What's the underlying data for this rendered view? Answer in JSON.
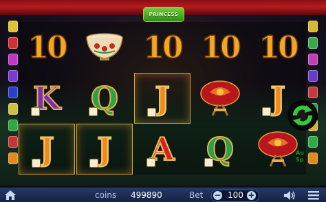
{
  "game": {
    "logo_text": "PRINCESS",
    "reels": [
      [
        "10",
        "K",
        "J"
      ],
      [
        "bowl",
        "Q",
        "J"
      ],
      [
        "10",
        "J",
        "A"
      ],
      [
        "10",
        "lantern",
        "Q"
      ],
      [
        "10",
        "J",
        "lantern"
      ]
    ],
    "winning_cells": [
      [
        0,
        2
      ],
      [
        1,
        2
      ],
      [
        2,
        1
      ]
    ],
    "auto_spin_label_line1": "Au",
    "auto_spin_label_line2": "Sp"
  },
  "bottom_bar": {
    "coins_label": "coins",
    "coins_value": "499890",
    "bet_label": "Bet",
    "bet_value": "100",
    "minus_label": "−",
    "plus_label": "+"
  },
  "icons": {
    "home": "home-icon",
    "sound": "speaker-icon",
    "menu": "menu-icon",
    "refresh": "refresh-icon"
  },
  "colors": {
    "curtain": "#b51b1f",
    "bar": "#1e3260",
    "accent": "#f3a624",
    "refresh_green": "#36c83c"
  }
}
